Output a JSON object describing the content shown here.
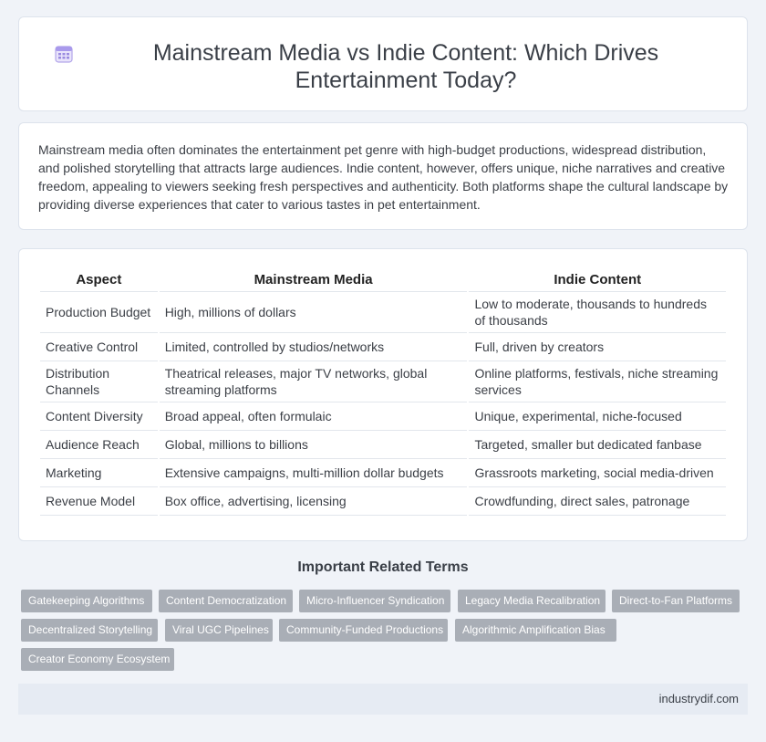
{
  "header": {
    "title": "Mainstream Media vs Indie Content: Which Drives Entertainment Today?",
    "icon": "calendar-icon"
  },
  "intro": {
    "text": "Mainstream media often dominates the entertainment pet genre with high-budget productions, widespread distribution, and polished storytelling that attracts large audiences. Indie content, however, offers unique, niche narratives and creative freedom, appealing to viewers seeking fresh perspectives and authenticity. Both platforms shape the cultural landscape by providing diverse experiences that cater to various tastes in pet entertainment."
  },
  "table": {
    "headers": [
      "Aspect",
      "Mainstream Media",
      "Indie Content"
    ],
    "rows": [
      [
        "Production Budget",
        "High, millions of dollars",
        "Low to moderate, thousands to hundreds of thousands"
      ],
      [
        "Creative Control",
        "Limited, controlled by studios/networks",
        "Full, driven by creators"
      ],
      [
        "Distribution Channels",
        "Theatrical releases, major TV networks, global streaming platforms",
        "Online platforms, festivals, niche streaming services"
      ],
      [
        "Content Diversity",
        "Broad appeal, often formulaic",
        "Unique, experimental, niche-focused"
      ],
      [
        "Audience Reach",
        "Global, millions to billions",
        "Targeted, smaller but dedicated fanbase"
      ],
      [
        "Marketing",
        "Extensive campaigns, multi-million dollar budgets",
        "Grassroots marketing, social media-driven"
      ],
      [
        "Revenue Model",
        "Box office, advertising, licensing",
        "Crowdfunding, direct sales, patronage"
      ]
    ]
  },
  "related": {
    "title": "Important Related Terms",
    "tags": [
      "Gatekeeping Algorithms",
      "Content Democratization",
      "Micro-Influencer Syndication",
      "Legacy Media Recalibration",
      "Direct-to-Fan Platforms",
      "Decentralized Storytelling",
      "Viral UGC Pipelines",
      "Community-Funded Productions",
      "Algorithmic Amplification Bias",
      "Creator Economy Ecosystem"
    ]
  },
  "footer": {
    "site": "industrydif.com"
  },
  "colors": {
    "background": "#f0f3f8",
    "tag": "#a9aeb6",
    "footer": "#e6ebf3"
  }
}
